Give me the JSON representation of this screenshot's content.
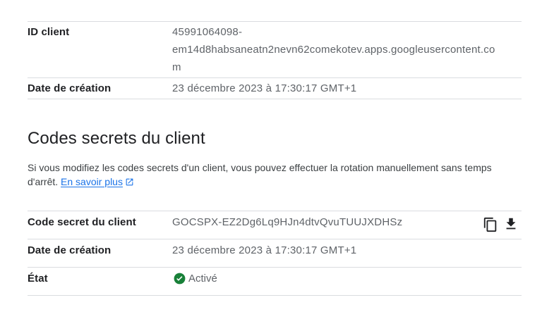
{
  "client_info": {
    "id_label": "ID client",
    "id_value_line1": "45991064098-",
    "id_value_line2": "em14d8habsaneatn2nevn62comekotev.apps.googleusercontent.co",
    "id_value_line3": "m",
    "created_label": "Date de création",
    "created_value": "23 décembre 2023 à 17:30:17 GMT+1"
  },
  "secrets_section": {
    "title": "Codes secrets du client",
    "description": "Si vous modifiez les codes secrets d'un client, vous pouvez effectuer la rotation manuellement sans temps d'arrêt.",
    "learn_more_label": "En savoir plus",
    "secret_label": "Code secret du client",
    "secret_value": "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",
    "created_label": "Date de création",
    "created_value": "23 décembre 2023 à 17:30:17 GMT+1",
    "state_label": "État",
    "state_value": "Activé"
  },
  "colors": {
    "link": "#1a73e8",
    "success": "#188038",
    "divider": "#dadce0"
  },
  "icons": {
    "copy": "copy-icon",
    "download": "download-icon",
    "external_link": "open-in-new-icon",
    "status": "check-circle-icon"
  }
}
